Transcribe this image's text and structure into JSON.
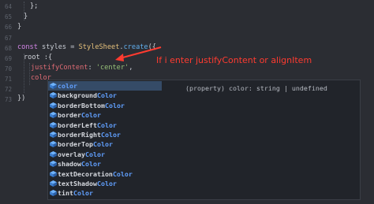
{
  "line_numbers": [
    "64",
    "65",
    "66",
    "67",
    "68",
    "69",
    "70",
    "71",
    "72",
    "73"
  ],
  "code": {
    "l64": "};",
    "l65": "}",
    "l66": "}",
    "l68_kw": "const",
    "l68_var": " styles = ",
    "l68_cls": "StyleSheet",
    "l68_dot": ".",
    "l68_fn": "create",
    "l68_end": "({",
    "l69": "root :{",
    "l70_prop": "justifyContent",
    "l70_colon": ": ",
    "l70_str": "'center'",
    "l70_comma": ",",
    "l71": "color",
    "l73": "})"
  },
  "annotation": "If i enter justifyContent or alignItem",
  "annotation_color": "#ff3b30",
  "suggestions": [
    {
      "prefix": "",
      "match": "color",
      "selected": true
    },
    {
      "prefix": "background",
      "match": "Color",
      "selected": false
    },
    {
      "prefix": "borderBottom",
      "match": "Color",
      "selected": false
    },
    {
      "prefix": "border",
      "match": "Color",
      "selected": false
    },
    {
      "prefix": "borderLeft",
      "match": "Color",
      "selected": false
    },
    {
      "prefix": "borderRight",
      "match": "Color",
      "selected": false
    },
    {
      "prefix": "borderTop",
      "match": "Color",
      "selected": false
    },
    {
      "prefix": "overlay",
      "match": "Color",
      "selected": false
    },
    {
      "prefix": "shadow",
      "match": "Color",
      "selected": false
    },
    {
      "prefix": "textDecoration",
      "match": "Color",
      "selected": false
    },
    {
      "prefix": "textShadow",
      "match": "Color",
      "selected": false
    },
    {
      "prefix": "tint",
      "match": "Color",
      "selected": false
    }
  ],
  "suggestion_icon": "property-cube-icon",
  "detail_text": "(property) color: string | undefined"
}
